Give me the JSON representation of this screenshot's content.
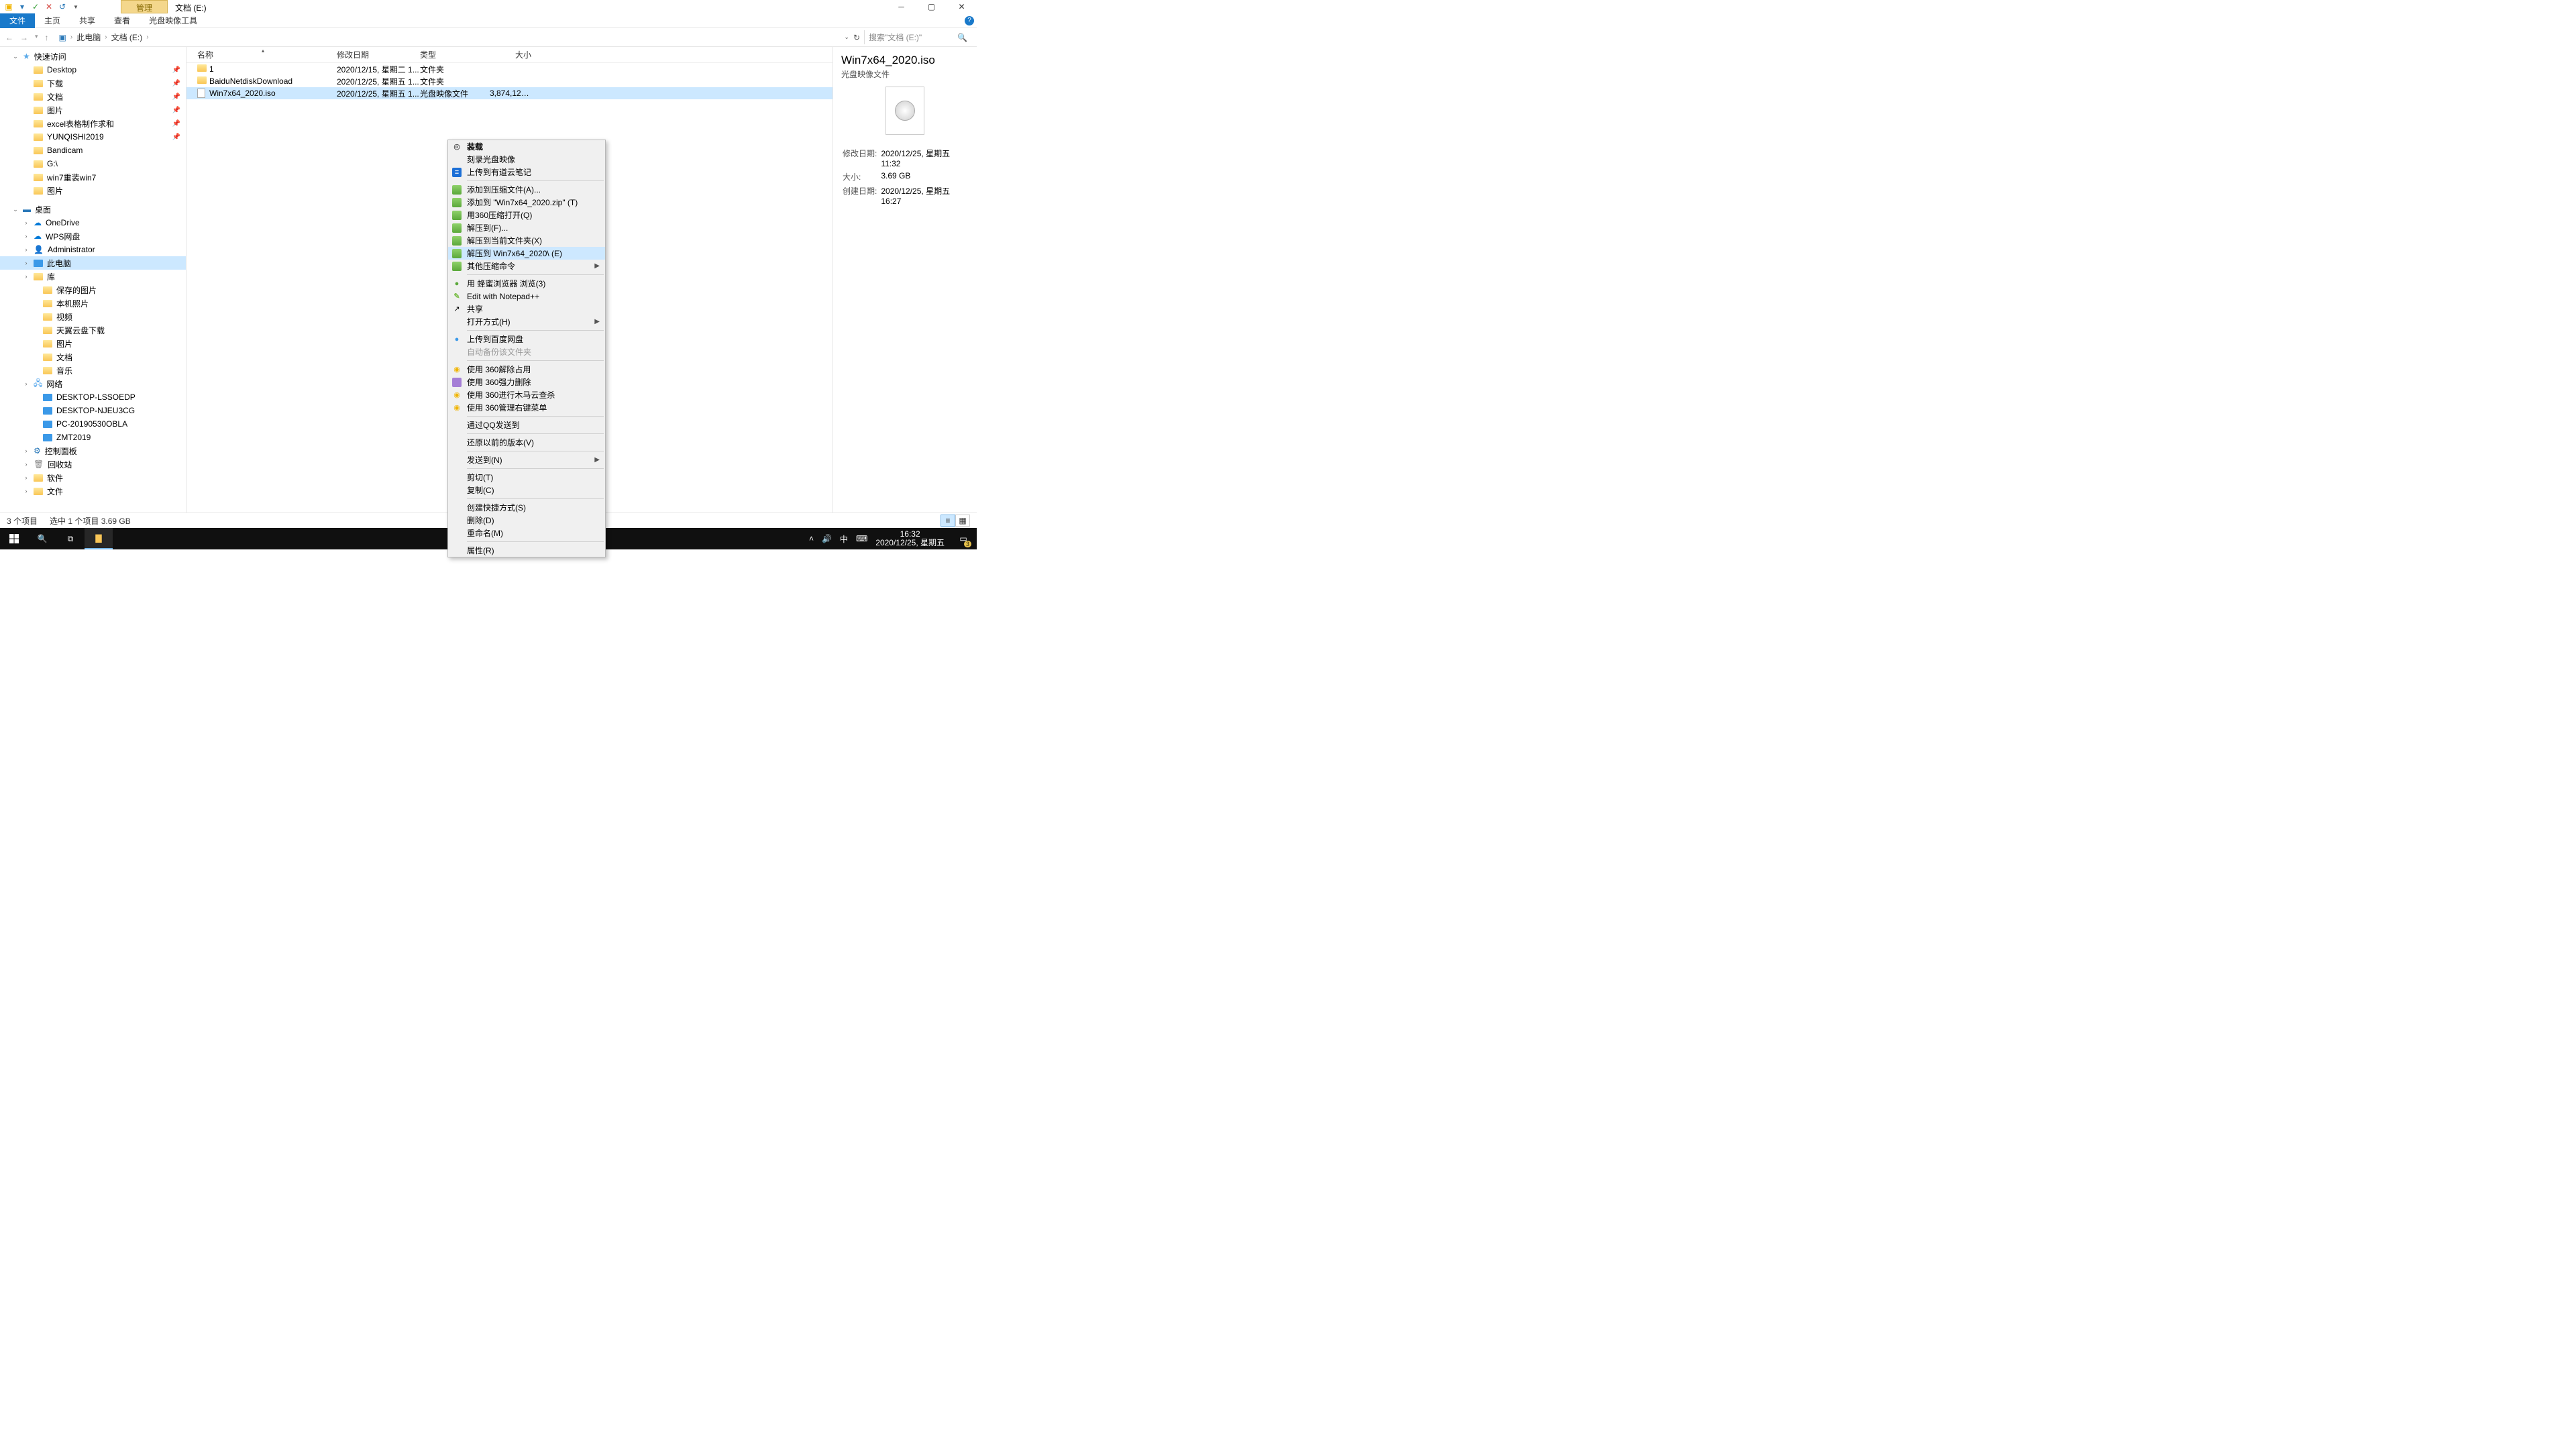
{
  "window": {
    "ribbon_context_tab": "管理",
    "title_tab": "文档 (E:)",
    "ribbon": {
      "file": "文件",
      "home": "主页",
      "share": "共享",
      "view": "查看",
      "iso_tools": "光盘映像工具"
    }
  },
  "breadcrumb": {
    "root": "此电脑",
    "folder": "文档 (E:)"
  },
  "search": {
    "placeholder": "搜索\"文档 (E:)\""
  },
  "sidebar": {
    "quick_access": "快速访问",
    "items_qa": [
      {
        "label": "Desktop",
        "pin": true
      },
      {
        "label": "下载",
        "pin": true
      },
      {
        "label": "文档",
        "pin": true
      },
      {
        "label": "图片",
        "pin": true
      },
      {
        "label": "excel表格制作求和",
        "pin": true
      },
      {
        "label": "YUNQISHI2019",
        "pin": true
      },
      {
        "label": "Bandicam"
      },
      {
        "label": "G:\\"
      },
      {
        "label": "win7重装win7"
      },
      {
        "label": "图片"
      }
    ],
    "desktop": "桌面",
    "items_dt": [
      {
        "label": "OneDrive",
        "ico": "cloud"
      },
      {
        "label": "WPS网盘",
        "ico": "cloud"
      },
      {
        "label": "Administrator",
        "ico": "user"
      },
      {
        "label": "此电脑",
        "ico": "computer",
        "selected": true
      },
      {
        "label": "库",
        "ico": "folder"
      },
      {
        "label": "保存的图片",
        "ico": "folder",
        "d": 2
      },
      {
        "label": "本机照片",
        "ico": "folder",
        "d": 2
      },
      {
        "label": "视频",
        "ico": "folder",
        "d": 2
      },
      {
        "label": "天翼云盘下载",
        "ico": "folder",
        "d": 2
      },
      {
        "label": "图片",
        "ico": "folder",
        "d": 2
      },
      {
        "label": "文档",
        "ico": "folder",
        "d": 2
      },
      {
        "label": "音乐",
        "ico": "folder",
        "d": 2
      },
      {
        "label": "网络",
        "ico": "net"
      },
      {
        "label": "DESKTOP-LSSOEDP",
        "ico": "computer",
        "d": 2
      },
      {
        "label": "DESKTOP-NJEU3CG",
        "ico": "computer",
        "d": 2
      },
      {
        "label": "PC-20190530OBLA",
        "ico": "computer",
        "d": 2
      },
      {
        "label": "ZMT2019",
        "ico": "computer",
        "d": 2
      },
      {
        "label": "控制面板",
        "ico": "cp"
      },
      {
        "label": "回收站",
        "ico": "bin"
      },
      {
        "label": "软件",
        "ico": "folder"
      },
      {
        "label": "文件",
        "ico": "folder"
      }
    ]
  },
  "list": {
    "headers": {
      "name": "名称",
      "date": "修改日期",
      "type": "类型",
      "size": "大小"
    },
    "rows": [
      {
        "name": "1",
        "date": "2020/12/15, 星期二 1...",
        "type": "文件夹",
        "size": "",
        "ico": "folder"
      },
      {
        "name": "BaiduNetdiskDownload",
        "date": "2020/12/25, 星期五 1...",
        "type": "文件夹",
        "size": "",
        "ico": "folder"
      },
      {
        "name": "Win7x64_2020.iso",
        "date": "2020/12/25, 星期五 1...",
        "type": "光盘映像文件",
        "size": "3,874,126...",
        "ico": "iso",
        "selected": true
      }
    ]
  },
  "context_menu": [
    {
      "label": "装载",
      "ico": "disc",
      "bold": true
    },
    {
      "label": "刻录光盘映像"
    },
    {
      "label": "上传到有道云笔记",
      "ico": "blue"
    },
    {
      "sep": true
    },
    {
      "label": "添加到压缩文件(A)...",
      "ico": "box"
    },
    {
      "label": "添加到 \"Win7x64_2020.zip\" (T)",
      "ico": "box"
    },
    {
      "label": "用360压缩打开(Q)",
      "ico": "box"
    },
    {
      "label": "解压到(F)...",
      "ico": "box"
    },
    {
      "label": "解压到当前文件夹(X)",
      "ico": "box"
    },
    {
      "label": "解压到 Win7x64_2020\\ (E)",
      "ico": "box",
      "hl": true
    },
    {
      "label": "其他压缩命令",
      "ico": "box",
      "sub": true
    },
    {
      "sep": true
    },
    {
      "label": "用 蜂蜜浏览器 浏览(3)",
      "ico": "green-dot"
    },
    {
      "label": "Edit with Notepad++",
      "ico": "np"
    },
    {
      "label": "共享",
      "ico": "share"
    },
    {
      "label": "打开方式(H)",
      "sub": true
    },
    {
      "sep": true
    },
    {
      "label": "上传到百度网盘",
      "ico": "cloud-dot"
    },
    {
      "label": "自动备份该文件夹",
      "disabled": true
    },
    {
      "sep": true
    },
    {
      "label": "使用 360解除占用",
      "ico": "shield"
    },
    {
      "label": "使用 360强力删除",
      "ico": "violet"
    },
    {
      "label": "使用 360进行木马云查杀",
      "ico": "shield"
    },
    {
      "label": "使用 360管理右键菜单",
      "ico": "shield"
    },
    {
      "sep": true
    },
    {
      "label": "通过QQ发送到"
    },
    {
      "sep": true
    },
    {
      "label": "还原以前的版本(V)"
    },
    {
      "sep": true
    },
    {
      "label": "发送到(N)",
      "sub": true
    },
    {
      "sep": true
    },
    {
      "label": "剪切(T)"
    },
    {
      "label": "复制(C)"
    },
    {
      "sep": true
    },
    {
      "label": "创建快捷方式(S)"
    },
    {
      "label": "删除(D)"
    },
    {
      "label": "重命名(M)"
    },
    {
      "sep": true
    },
    {
      "label": "属性(R)"
    }
  ],
  "preview": {
    "title": "Win7x64_2020.iso",
    "subtype": "光盘映像文件",
    "fields": [
      {
        "k": "修改日期:",
        "v": "2020/12/25, 星期五 11:32"
      },
      {
        "k": "大小:",
        "v": "3.69 GB"
      },
      {
        "k": "创建日期:",
        "v": "2020/12/25, 星期五 16:27"
      }
    ]
  },
  "status": {
    "count": "3 个项目",
    "sel": "选中 1 个项目  3.69 GB"
  },
  "taskbar": {
    "ime": "中",
    "time": "16:32",
    "date": "2020/12/25, 星期五",
    "notif_count": "3"
  }
}
